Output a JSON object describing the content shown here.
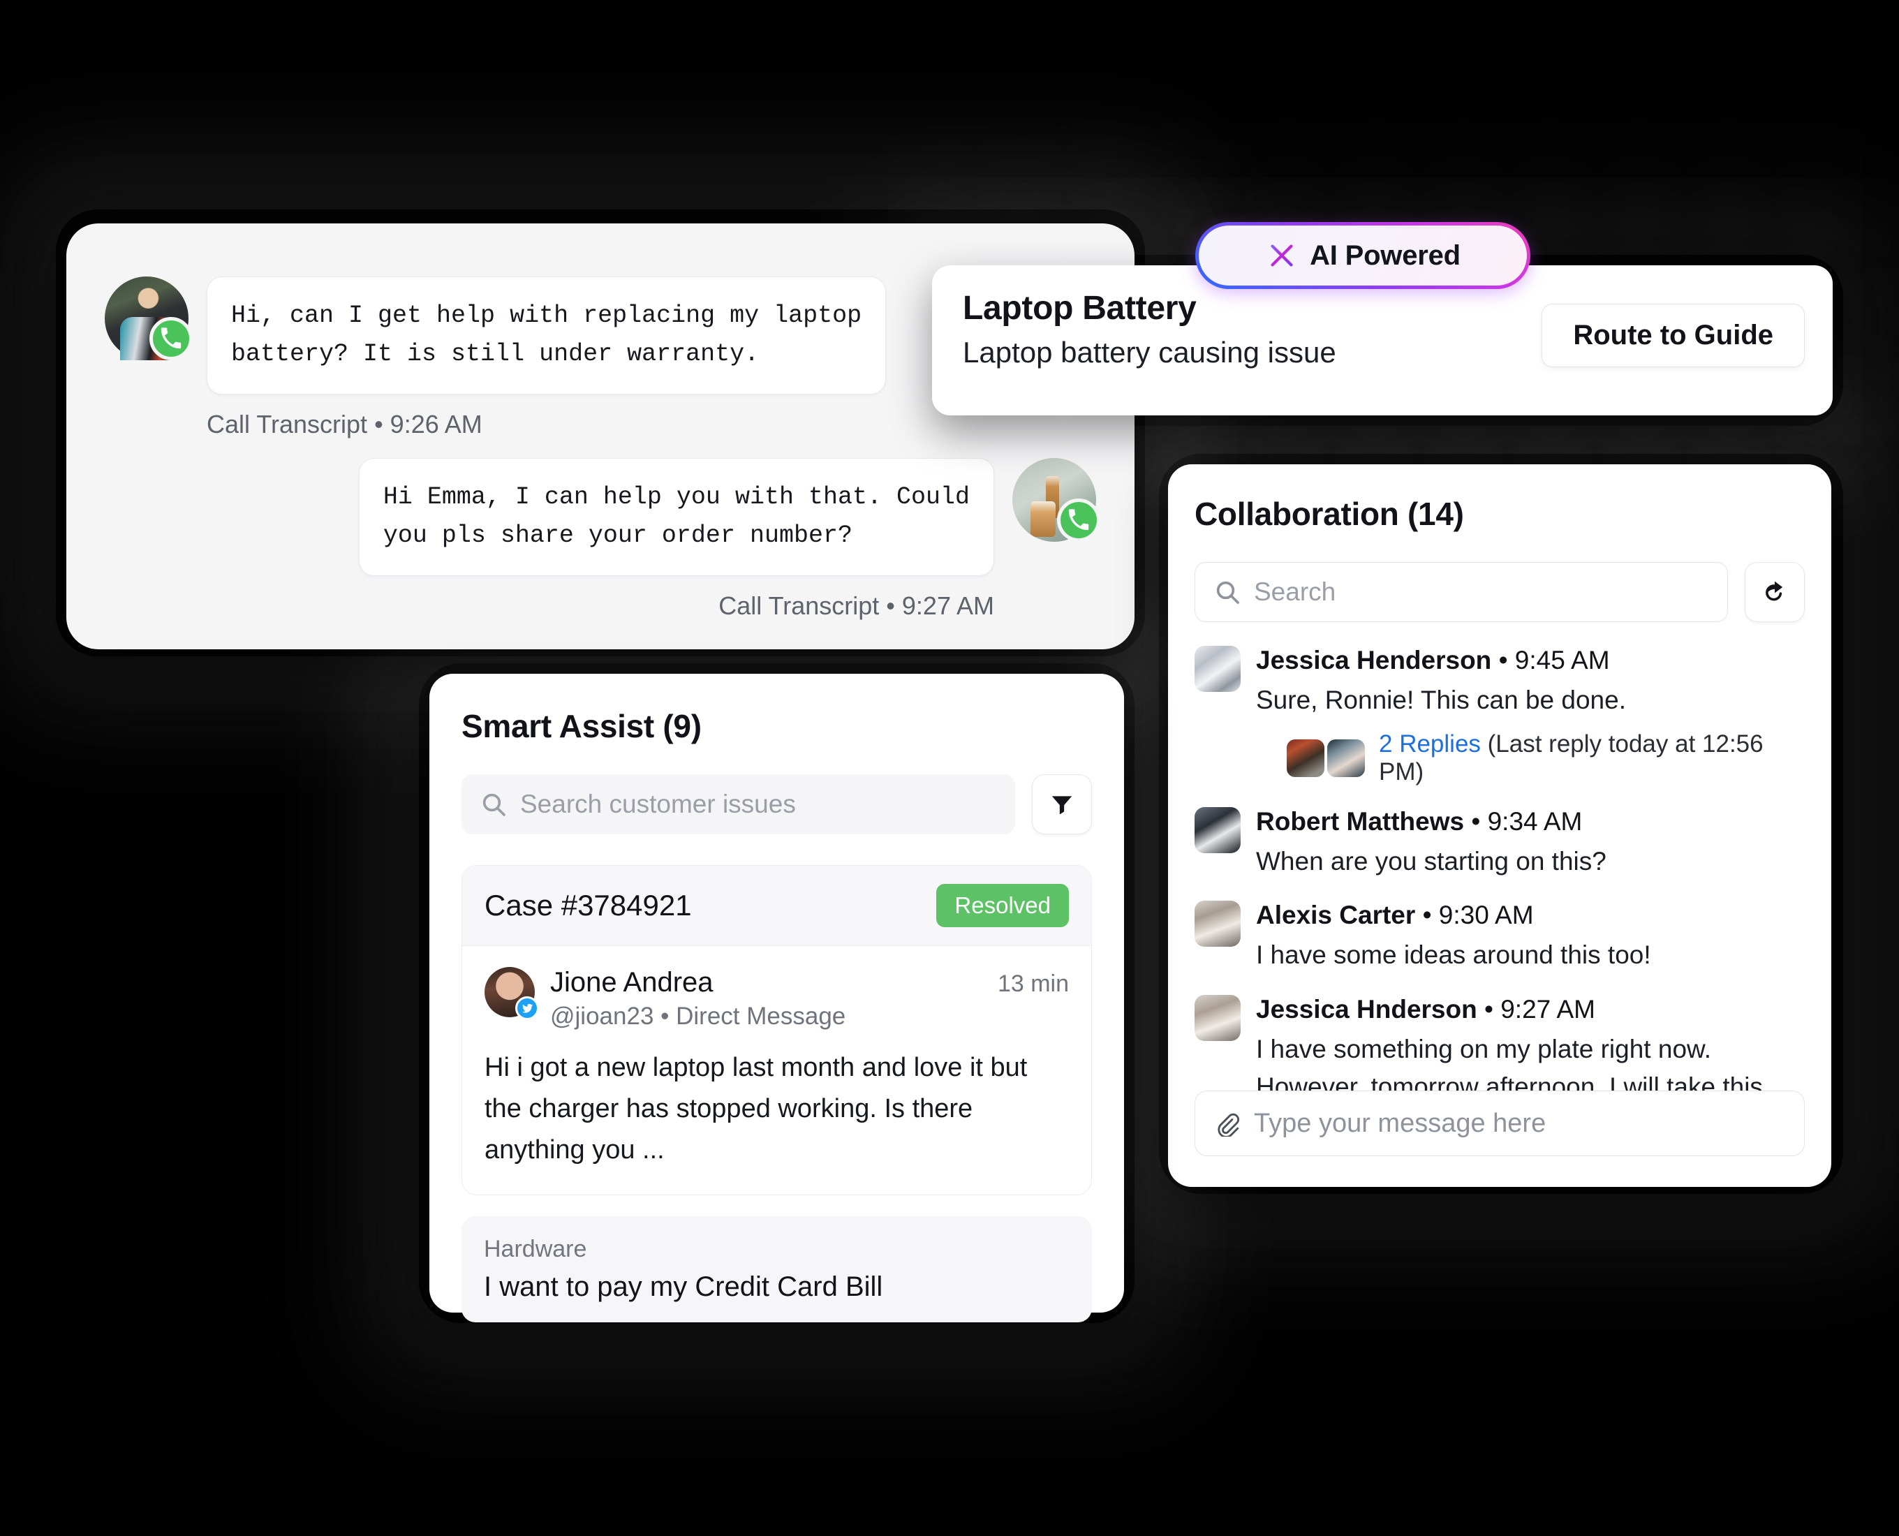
{
  "chat": {
    "messages": [
      {
        "text": "Hi, can I get help with replacing my laptop\nbattery? It is still under warranty.",
        "meta": "Call Transcript • 9:26 AM",
        "side": "left"
      },
      {
        "text": "Hi Emma, I can help you with that. Could\nyou pls share your order number?",
        "meta": "Call Transcript • 9:27 AM",
        "side": "right"
      }
    ]
  },
  "ai_badge": {
    "label": "AI Powered",
    "icon": "sparkle-icon"
  },
  "battery_card": {
    "title": "Laptop Battery",
    "subtitle": "Laptop battery causing issue",
    "route_button": "Route to Guide"
  },
  "smart_assist": {
    "title": "Smart Assist (9)",
    "search_placeholder": "Search customer issues",
    "search_value": "",
    "filter_icon": "filter-icon",
    "case": {
      "id": "Case #3784921",
      "status": "Resolved",
      "status_color": "#5cc265",
      "author": "Jione Andrea",
      "handle": "@jioan23 • Direct Message",
      "time_ago": "13 min",
      "body": "Hi i got a new laptop last month and love it but the charger has stopped working.  Is there anything you ..."
    },
    "hardware": {
      "label": "Hardware",
      "text": "I want to pay my Credit Card Bill"
    }
  },
  "collaboration": {
    "title": "Collaboration (14)",
    "search_placeholder": "Search",
    "search_value": "",
    "share_icon": "share-icon",
    "messages": [
      {
        "name": "Jessica Henderson",
        "time": " • 9:45 AM",
        "text": "Sure, Ronnie! This can be done.",
        "replies_link": "2 Replies",
        "replies_meta": " (Last reply today at 12:56 PM)"
      },
      {
        "name": "Robert Matthews",
        "time": " • 9:34 AM",
        "text": "When are you starting on this?"
      },
      {
        "name": "Alexis Carter",
        "time": " • 9:30 AM",
        "text": "I have some ideas around this too!"
      },
      {
        "name": "Jessica Hnderson",
        "time": " • 9:27 AM",
        "text": "I have something on my plate right now. However, tomorrow afternoon, I will take this up."
      }
    ],
    "input_placeholder": "Type your message here",
    "input_value": "",
    "attach_icon": "paperclip-icon"
  }
}
